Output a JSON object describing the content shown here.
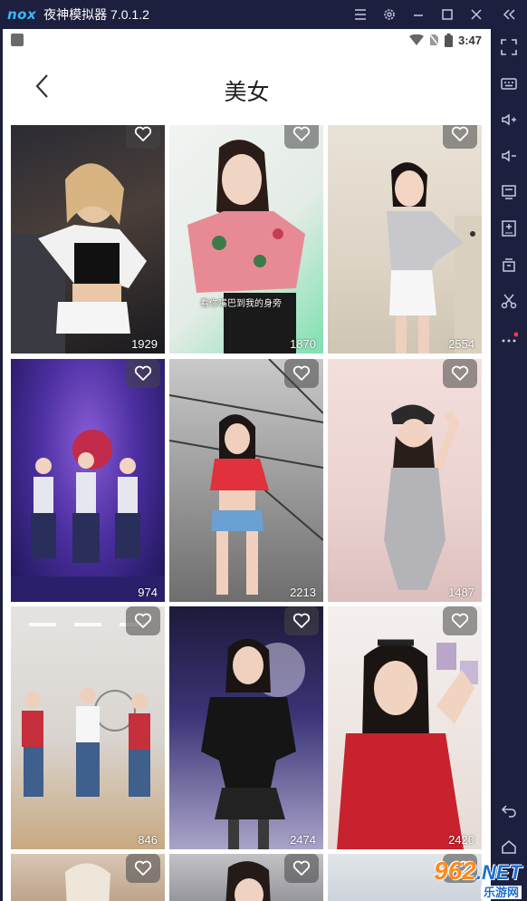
{
  "window": {
    "logo": "nox",
    "title": "夜神模拟器 7.0.1.2",
    "controls": [
      "menu-icon",
      "settings-icon",
      "minimize-icon",
      "maximize-icon",
      "close-icon",
      "collapse-sidebar-icon"
    ]
  },
  "status_bar": {
    "time": "3:47",
    "icons": [
      "notification-icon",
      "wifi-icon",
      "no-sim-icon",
      "battery-icon"
    ]
  },
  "header": {
    "title": "美女",
    "back_icon": "chevron-left-icon"
  },
  "videos": [
    {
      "count": "1929"
    },
    {
      "count": "1870",
      "caption": "看你嘴巴到我的身旁"
    },
    {
      "count": "2554"
    },
    {
      "count": "974"
    },
    {
      "count": "2213"
    },
    {
      "count": "1487"
    },
    {
      "count": "846"
    },
    {
      "count": "2474"
    },
    {
      "count": "2420"
    },
    {
      "count": ""
    },
    {
      "count": ""
    },
    {
      "count": ""
    }
  ],
  "sidebar_tools": [
    "fullscreen-icon",
    "keyboard-icon",
    "volume-up-icon",
    "volume-down-icon",
    "screen-icon",
    "apk-install-icon",
    "multi-instance-icon",
    "scissors-icon",
    "more-icon",
    "back-icon",
    "home-icon"
  ],
  "watermark": {
    "number": "962",
    "suffix": ".NET",
    "text": "乐游网"
  },
  "colors": {
    "chrome": "#1d1f3e",
    "accent": "#36b8ff",
    "watermark_orange": "#ff8a1c",
    "watermark_blue": "#1a6fd1"
  }
}
